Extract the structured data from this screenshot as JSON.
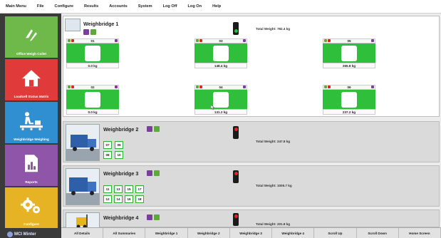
{
  "menu": [
    "Main Menu",
    "File",
    "Configure",
    "Results",
    "Accounts",
    "System",
    "Log Off",
    "Log On",
    "Help"
  ],
  "sidebar": [
    {
      "label": "Office Weigh Coilet",
      "icon": "weigh-logo-icon"
    },
    {
      "label": "Loadcell Status Matrix",
      "icon": "home-icon"
    },
    {
      "label": "Weighbridge Weighing",
      "icon": "conveyor-person-icon"
    },
    {
      "label": "Reports",
      "icon": "report-chart-icon"
    },
    {
      "label": "Configure",
      "icon": "gears-icon"
    }
  ],
  "brand": "MCI Minter",
  "weighbridge1": {
    "title": "Weighbridge 1",
    "total": "Total Weight: 782.4 kg",
    "cells": [
      {
        "id": "01",
        "weight": "0.0 kg"
      },
      {
        "id": "03",
        "weight": "148.4 kg"
      },
      {
        "id": "05",
        "weight": "265.8 kg"
      },
      {
        "id": "02",
        "weight": "0.0 kg"
      },
      {
        "id": "04",
        "weight": "131.2 kg"
      },
      {
        "id": "06",
        "weight": "237.2 kg"
      }
    ]
  },
  "weighbridge2": {
    "title": "Weighbridge 2",
    "total": "Total Weight: 247.8 kg",
    "cells": [
      "07",
      "09",
      "08",
      "10"
    ]
  },
  "weighbridge3": {
    "title": "Weighbridge 3",
    "total": "Total Weight: 1005.7 kg",
    "cells": [
      "11",
      "13",
      "15",
      "17",
      "12",
      "14",
      "16",
      "18"
    ]
  },
  "weighbridge4": {
    "title": "Weighbridge 4",
    "total": "Total Weight: 201.8 kg"
  },
  "bottom": [
    "All Details",
    "All Summaries",
    "Weighbridge 1",
    "Weighbridge 2",
    "Weighbridge 3",
    "Weighbridge 4",
    "Scroll Up",
    "Scroll Down",
    "Home Screen"
  ],
  "colors": {
    "green": "#2fbf3a",
    "red_light": "#e02424",
    "green_light": "#22c43a",
    "tile_green": "#6fb94a",
    "tile_red": "#e03a3a",
    "tile_blue": "#2f8fd1",
    "tile_purple": "#8e55a8",
    "tile_yellow": "#e6b324"
  }
}
